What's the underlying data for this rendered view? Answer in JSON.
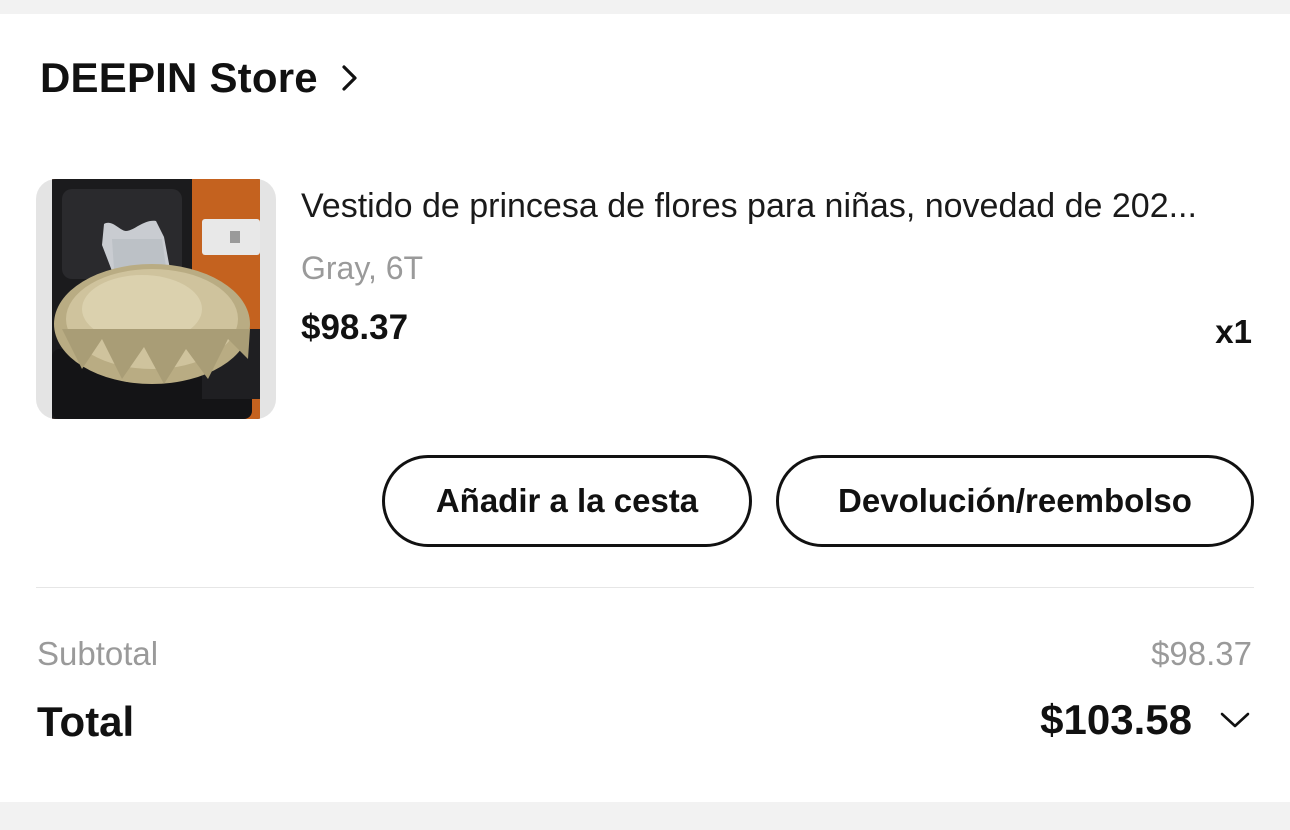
{
  "store": {
    "name": "DEEPIN Store"
  },
  "item": {
    "title": "Vestido de princesa de flores para niñas, novedad de 202...",
    "variant": "Gray, 6T",
    "price": "$98.37",
    "quantity": "x1",
    "image_icon": "product-photo-dress"
  },
  "actions": {
    "add_to_cart": "Añadir a la cesta",
    "return_refund": "Devolución/reembolso"
  },
  "summary": {
    "subtotal_label": "Subtotal",
    "subtotal_value": "$98.37",
    "total_label": "Total",
    "total_value": "$103.58"
  },
  "colors": {
    "text_primary": "#111111",
    "text_secondary": "#9a9a9a",
    "background": "#f2f2f2",
    "card": "#ffffff"
  }
}
